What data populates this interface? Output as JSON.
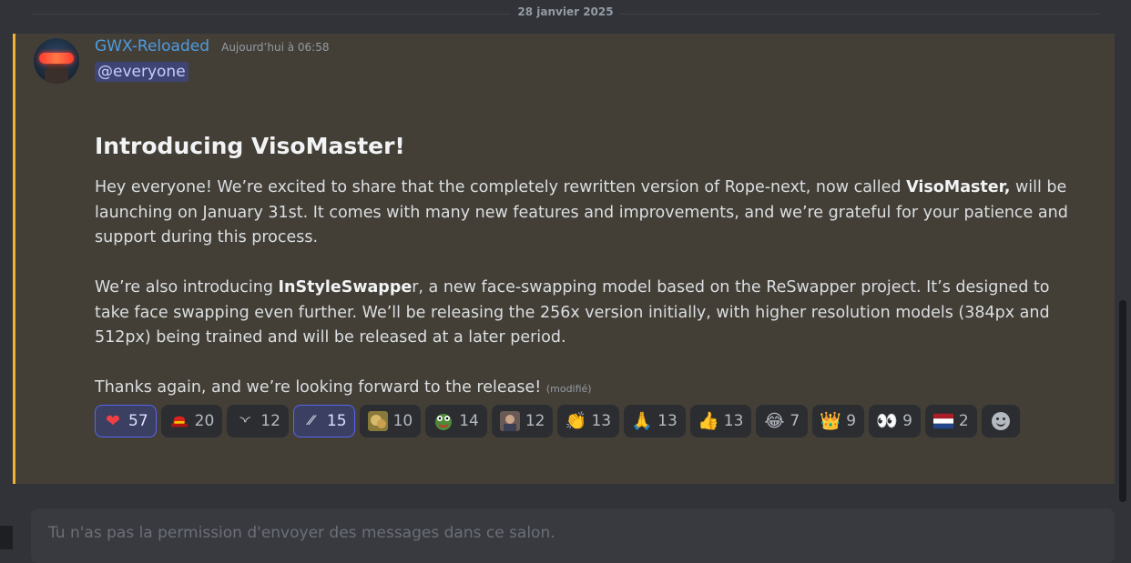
{
  "date_divider": "28 janvier 2025",
  "message": {
    "username": "GWX-Reloaded",
    "timestamp": "Aujourd’hui à 06:58",
    "mention": "@everyone",
    "title": "Introducing VisoMaster!",
    "p1_a": "Hey everyone! We’re excited to share that the completely rewritten version of Rope-next, now called ",
    "p1_bold": "VisoMaster,",
    "p1_b": " will be launching on January 31st. It comes with many new features and improvements, and we’re grateful for your patience and support during this process.",
    "p2_a": "We’re also introducing ",
    "p2_bold": "InStyleSwappe",
    "p2_b": "r, a new face-swapping model based on the ReSwapper project. It’s designed to take face swapping even further. We’ll be releasing the 256x version initially, with higher resolution models (384px and 512px) being trained and will be released at a later period.",
    "p3": "Thanks again, and we’re looking forward to the release!",
    "edited": "(modifié)"
  },
  "reactions": [
    {
      "icon": "heart-icon",
      "glyph": "❤",
      "count": "57",
      "me": true
    },
    {
      "icon": "red-hat-icon",
      "glyph": "",
      "count": "20",
      "me": false
    },
    {
      "icon": "closed-eyes-icon",
      "glyph": "◝◜",
      "count": "12",
      "me": false
    },
    {
      "icon": "pencil-icon",
      "glyph": "⁄⁄",
      "count": "15",
      "me": true
    },
    {
      "icon": "dog-emote-icon",
      "glyph": "",
      "count": "10",
      "me": false
    },
    {
      "icon": "frog-emote-icon",
      "glyph": "",
      "count": "14",
      "me": false
    },
    {
      "icon": "photo-emote-icon",
      "glyph": "",
      "count": "12",
      "me": false
    },
    {
      "icon": "clapping-hands-icon",
      "glyph": "👏",
      "count": "13",
      "me": false
    },
    {
      "icon": "folded-hands-icon",
      "glyph": "🙏",
      "count": "13",
      "me": false
    },
    {
      "icon": "thumbs-up-icon",
      "glyph": "👍",
      "count": "13",
      "me": false
    },
    {
      "icon": "tears-of-joy-icon",
      "glyph": "😂",
      "count": "7",
      "me": false
    },
    {
      "icon": "crown-icon",
      "glyph": "👑",
      "count": "9",
      "me": false
    },
    {
      "icon": "eyes-icon",
      "glyph": "👀",
      "count": "9",
      "me": false
    },
    {
      "icon": "netherlands-flag-icon",
      "glyph": "",
      "count": "2",
      "me": false
    }
  ],
  "colors": {
    "accent_mention": "#f0b232",
    "reaction_me_border": "#5865f2",
    "username": "#4e9be0"
  },
  "composer": {
    "placeholder": "Tu n'as pas la permission d'envoyer des messages dans ce salon."
  }
}
